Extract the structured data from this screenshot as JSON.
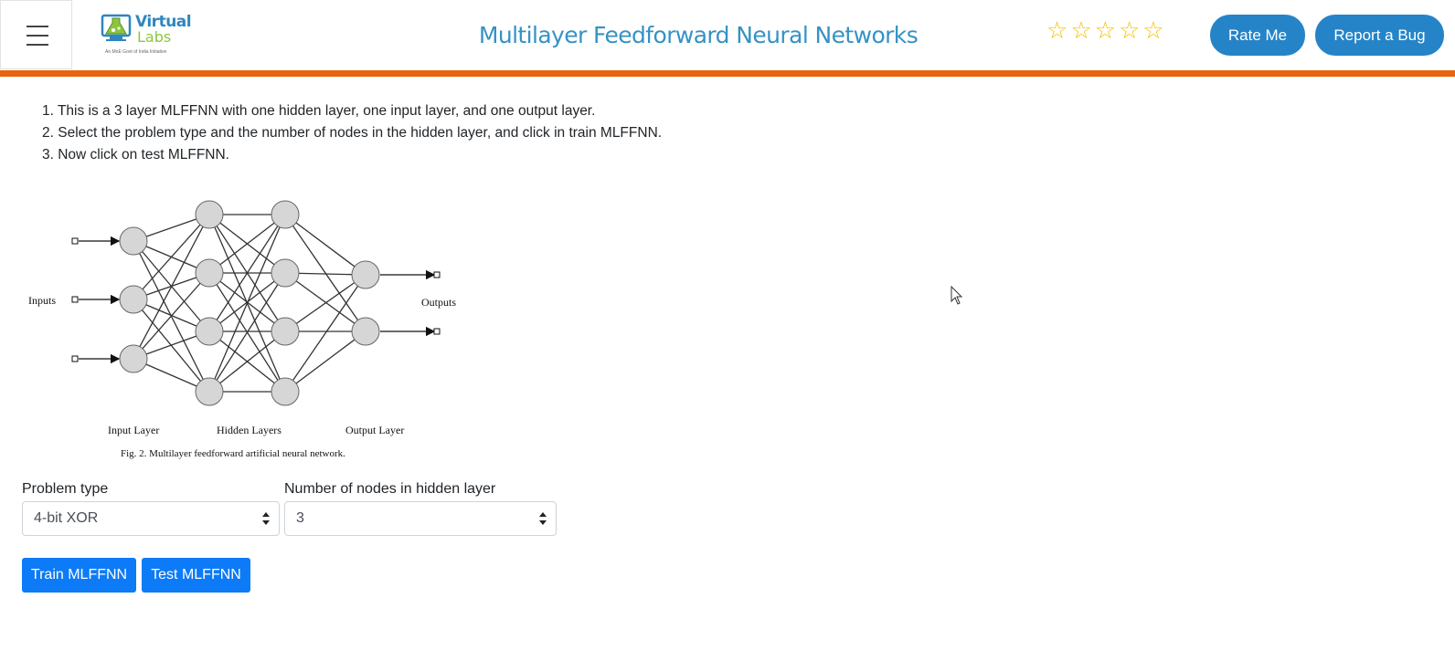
{
  "header": {
    "title": "Multilayer Feedforward Neural Networks",
    "logo": {
      "word1": "Virtual",
      "word2": "Labs",
      "tagline": "An MoE Govt of India Initiative"
    },
    "rating_stars": 5,
    "rate_button": "Rate Me",
    "bug_button": "Report a Bug"
  },
  "instructions": [
    "1. This is a 3 layer MLFFNN with one hidden layer, one input layer, and one output layer.",
    "2. Select the problem type and the number of nodes in the hidden layer, and click in train MLFFNN.",
    "3. Now click on test MLFFNN."
  ],
  "figure": {
    "inputs_label": "Inputs",
    "outputs_label": "Outputs",
    "input_layer_label": "Input Layer",
    "hidden_layers_label": "Hidden Layers",
    "output_layer_label": "Output Layer",
    "caption": "Fig. 2. Multilayer feedforward artificial neural network."
  },
  "form": {
    "problem_type_label": "Problem type",
    "problem_type_value": "4-bit XOR",
    "nodes_label": "Number of nodes in hidden layer",
    "nodes_value": "3"
  },
  "actions": {
    "train": "Train MLFFNN",
    "test": "Test MLFFNN"
  },
  "colors": {
    "accent_orange": "#e8650e",
    "title_blue": "#3592c4",
    "pill_blue": "#2584c8",
    "button_blue": "#0d7bf7",
    "star_gold": "#f2c200"
  }
}
